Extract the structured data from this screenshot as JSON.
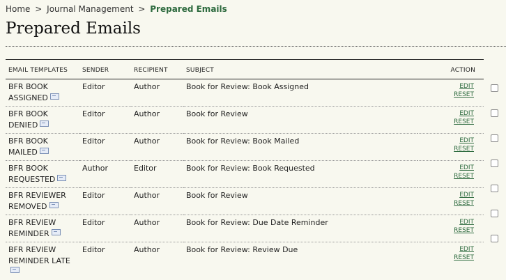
{
  "breadcrumb": {
    "home": "Home",
    "separator": ">",
    "journal_management": "Journal Management",
    "current": "Prepared Emails"
  },
  "page_title": "Prepared Emails",
  "table": {
    "headers": {
      "email_templates": "EMAIL TEMPLATES",
      "sender": "SENDER",
      "recipient": "RECIPIENT",
      "subject": "SUBJECT",
      "action": "ACTION"
    },
    "action_labels": {
      "edit": "EDIT",
      "reset": "RESET"
    },
    "rows": [
      {
        "template": "BFR BOOK ASSIGNED",
        "sender": "Editor",
        "recipient": "Author",
        "subject": "Book for Review: Book Assigned"
      },
      {
        "template": "BFR BOOK DENIED",
        "sender": "Editor",
        "recipient": "Author",
        "subject": "Book for Review"
      },
      {
        "template": "BFR BOOK MAILED",
        "sender": "Editor",
        "recipient": "Author",
        "subject": "Book for Review: Book Mailed"
      },
      {
        "template": "BFR BOOK REQUESTED",
        "sender": "Author",
        "recipient": "Editor",
        "subject": "Book for Review: Book Requested"
      },
      {
        "template": "BFR REVIEWER REMOVED",
        "sender": "Editor",
        "recipient": "Author",
        "subject": "Book for Review"
      },
      {
        "template": "BFR REVIEW REMINDER",
        "sender": "Editor",
        "recipient": "Author",
        "subject": "Book for Review: Due Date Reminder"
      },
      {
        "template": "BFR REVIEW REMINDER LATE",
        "sender": "Editor",
        "recipient": "Author",
        "subject": "Book for Review: Review Due"
      }
    ]
  }
}
